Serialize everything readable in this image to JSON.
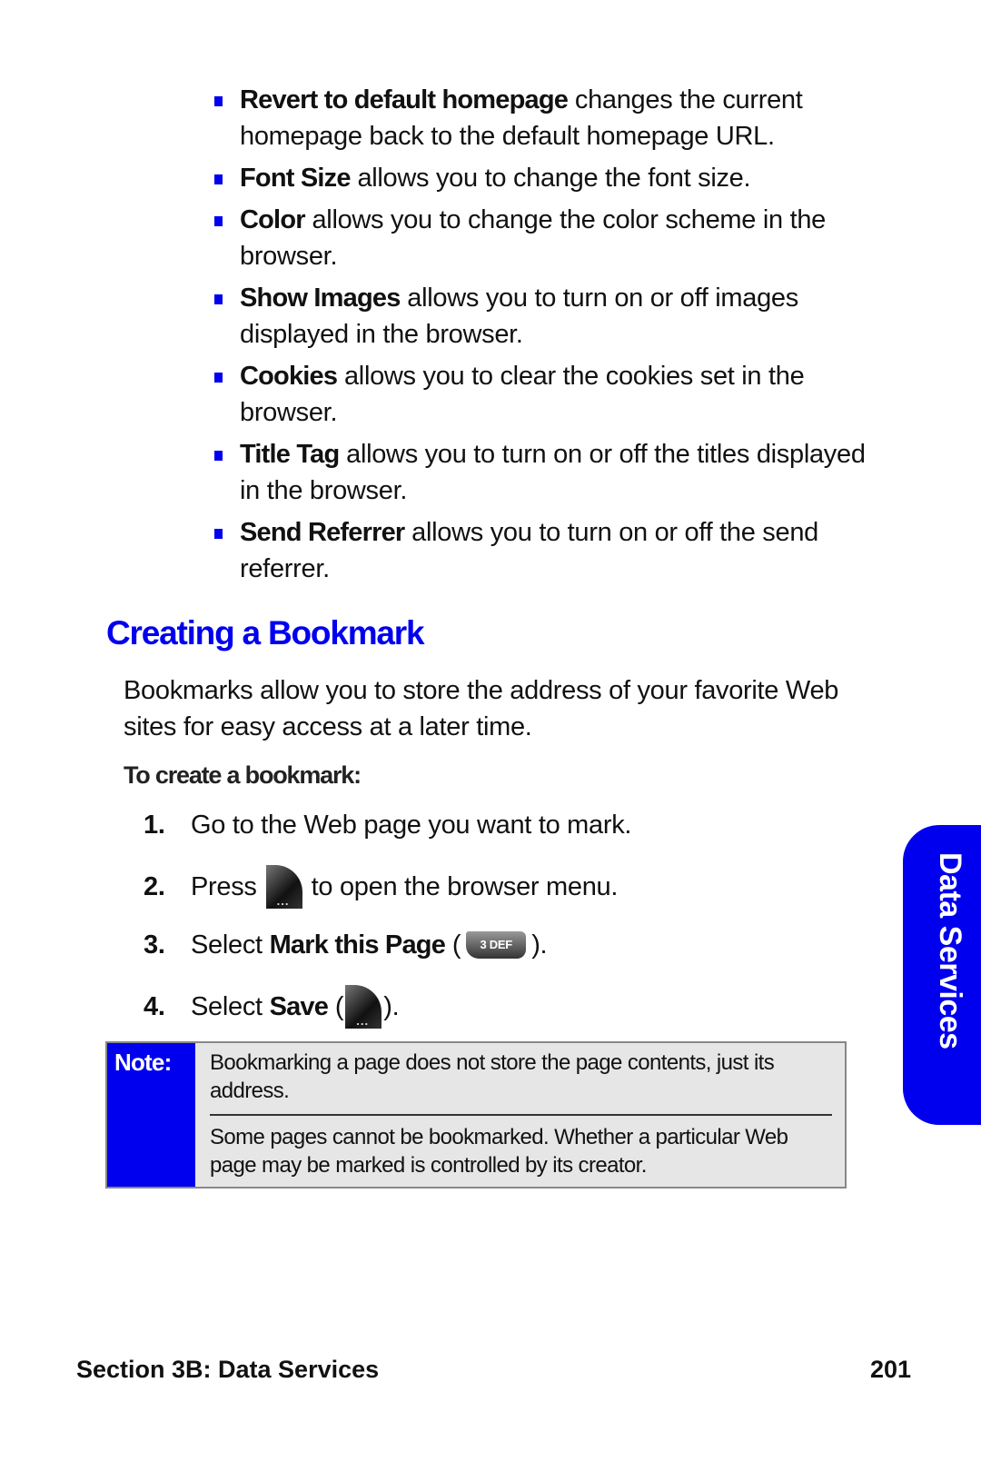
{
  "options": [
    {
      "term": "Revert to default homepage",
      "desc": " changes the current homepage back to the default homepage URL."
    },
    {
      "term": "Font Size",
      "desc": " allows you to change the font size."
    },
    {
      "term": "Color",
      "desc": " allows you to change the color scheme in the browser."
    },
    {
      "term": "Show Images",
      "desc": " allows you to turn on or off images displayed in the browser."
    },
    {
      "term": "Cookies",
      "desc": " allows you to clear the cookies set in the browser."
    },
    {
      "term": "Title Tag",
      "desc": " allows you to turn on or off the titles displayed in the browser."
    },
    {
      "term": "Send Referrer",
      "desc": " allows you to turn on or off the send referrer."
    }
  ],
  "section": {
    "heading": "Creating a Bookmark",
    "intro": "Bookmarks allow you to store the address of your favorite Web sites for easy access at a later time.",
    "subheading": "To create a bookmark:"
  },
  "steps": [
    {
      "num": "1.",
      "text": "Go to the Web page you want to mark."
    },
    {
      "num": "2.",
      "pre": "Press",
      "post": "to open the browser menu.",
      "icon": "menu-softkey-icon",
      "icon_text": "..."
    },
    {
      "num": "3.",
      "pre": "Select ",
      "bold": "Mark this Page",
      "open": " (",
      "close": ").",
      "icon": "key-3-icon",
      "icon_text": "3 DEF"
    },
    {
      "num": "4.",
      "pre": "Select ",
      "bold": "Save",
      "open": " (",
      "close": ").",
      "icon": "menu-softkey-icon",
      "icon_text": "..."
    }
  ],
  "note": {
    "label": "Note:",
    "items": [
      "Bookmarking a page does not store the page contents, just its address.",
      "Some pages cannot be bookmarked. Whether a particular Web page may be marked is controlled by its creator."
    ]
  },
  "side_tab": {
    "label": "Data Services"
  },
  "footer": {
    "section": "Section 3B: Data Services",
    "page": "201"
  },
  "colors": {
    "accent": "#0000ee",
    "note_bg": "#e6e6e6"
  }
}
